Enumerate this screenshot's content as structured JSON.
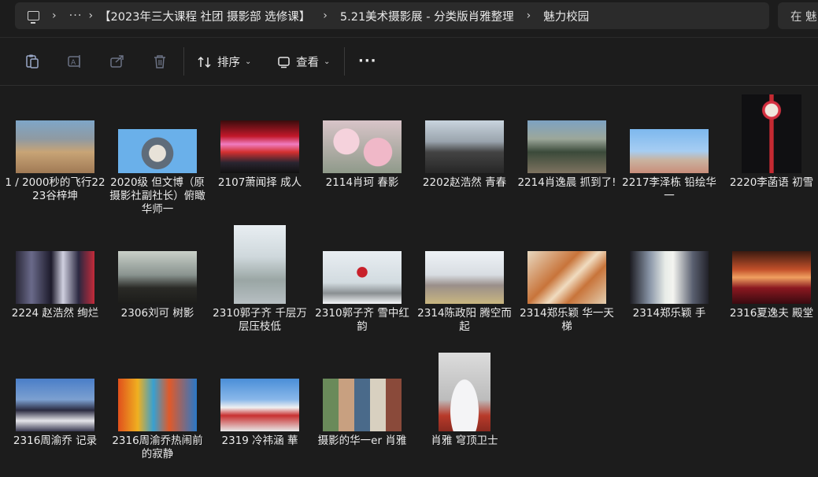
{
  "breadcrumb": {
    "more": "···",
    "segments": [
      "【2023年三大课程 社团 摄影部 选修课】",
      "5.21美术摄影展 - 分类版肖雅整理",
      "魅力校园"
    ]
  },
  "search": {
    "text": "在 魅"
  },
  "toolbar": {
    "sort_label": "排序",
    "view_label": "查看",
    "more_label": "···"
  },
  "files": [
    {
      "name": "1 / 2000秒的飞行2223谷梓坤",
      "thumb": "sports-field-photo"
    },
    {
      "name": "2020级 但文博（原摄影社副社长）俯瞰华师一",
      "thumb": "tiny-planet-photo"
    },
    {
      "name": "2107萧闻择 成人",
      "thumb": "stage-ceremony-photo"
    },
    {
      "name": "2114肖珂 春影",
      "thumb": "blossom-photo"
    },
    {
      "name": "2202赵浩然 青春",
      "thumb": "campus-students-photo"
    },
    {
      "name": "2214肖逸晨 抓到了!",
      "thumb": "outdoor-group-photo"
    },
    {
      "name": "2217李泽栋 铅绘华一",
      "thumb": "building-sky-photo"
    },
    {
      "name": "2220李菡语 初雪",
      "thumb": "night-snow-tower-photo"
    },
    {
      "name": "2224 赵浩然 绚烂",
      "thumb": "stage-performance-photo"
    },
    {
      "name": "2306刘可 树影",
      "thumb": "tree-silhouette-photo"
    },
    {
      "name": "2310郭子齐 千层万层压枝低",
      "thumb": "snowy-trees-photo"
    },
    {
      "name": "2310郭子齐 雪中红韵",
      "thumb": "snowy-red-sculpture-photo"
    },
    {
      "name": "2314陈政阳 腾空而起",
      "thumb": "jumping-athlete-photo"
    },
    {
      "name": "2314郑乐颖 华一天梯",
      "thumb": "red-tower-structure-photo"
    },
    {
      "name": "2314郑乐颖 手",
      "thumb": "hand-pillar-photo"
    },
    {
      "name": "2316夏逸夫 殿堂",
      "thumb": "auditorium-photo"
    },
    {
      "name": "2316周渝乔 记录",
      "thumb": "students-group-photo"
    },
    {
      "name": "2316周渝乔热闹前的寂静",
      "thumb": "colorful-playground-photo"
    },
    {
      "name": "2319 冷祎涵 華",
      "thumb": "school-building-photo"
    },
    {
      "name": "摄影的华一er 肖雅",
      "thumb": "photo-collage"
    },
    {
      "name": "肖雅 穹顶卫士",
      "thumb": "dome-building-photo"
    }
  ]
}
